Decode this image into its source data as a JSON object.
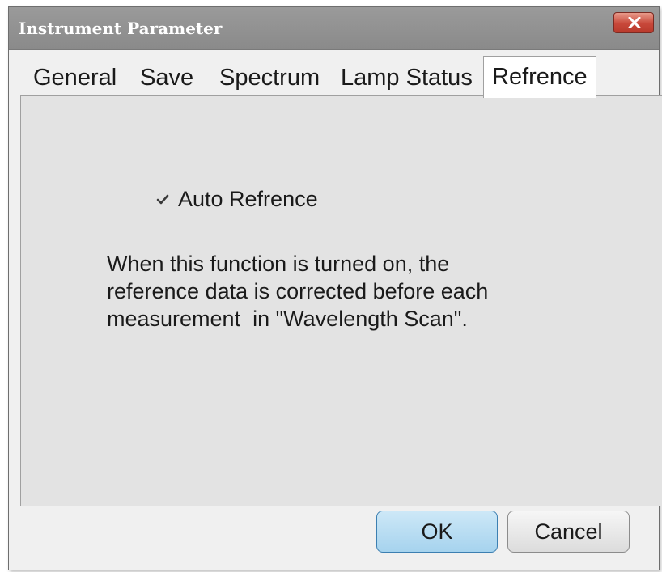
{
  "window": {
    "title": "Instrument Parameter"
  },
  "tabs": [
    {
      "label": "General"
    },
    {
      "label": "Save"
    },
    {
      "label": "Spectrum"
    },
    {
      "label": "Lamp Status"
    },
    {
      "label": "Refrence",
      "active": true
    }
  ],
  "panel": {
    "checkbox": {
      "label": "Auto Refrence",
      "checked": true
    },
    "description": [
      "When this function is turned on, the",
      "reference data is corrected before each",
      "measurement  in \"Wavelength Scan\"."
    ]
  },
  "buttons": {
    "ok_label": "OK",
    "cancel_label": "Cancel"
  },
  "icons": {
    "close": "close-icon",
    "check": "checkmark-icon"
  },
  "colors": {
    "titlebar": "#8f8f8f",
    "close_button": "#c8483a",
    "panel_bg": "#e3e3e3",
    "ok_button": "#b6dcf2"
  }
}
